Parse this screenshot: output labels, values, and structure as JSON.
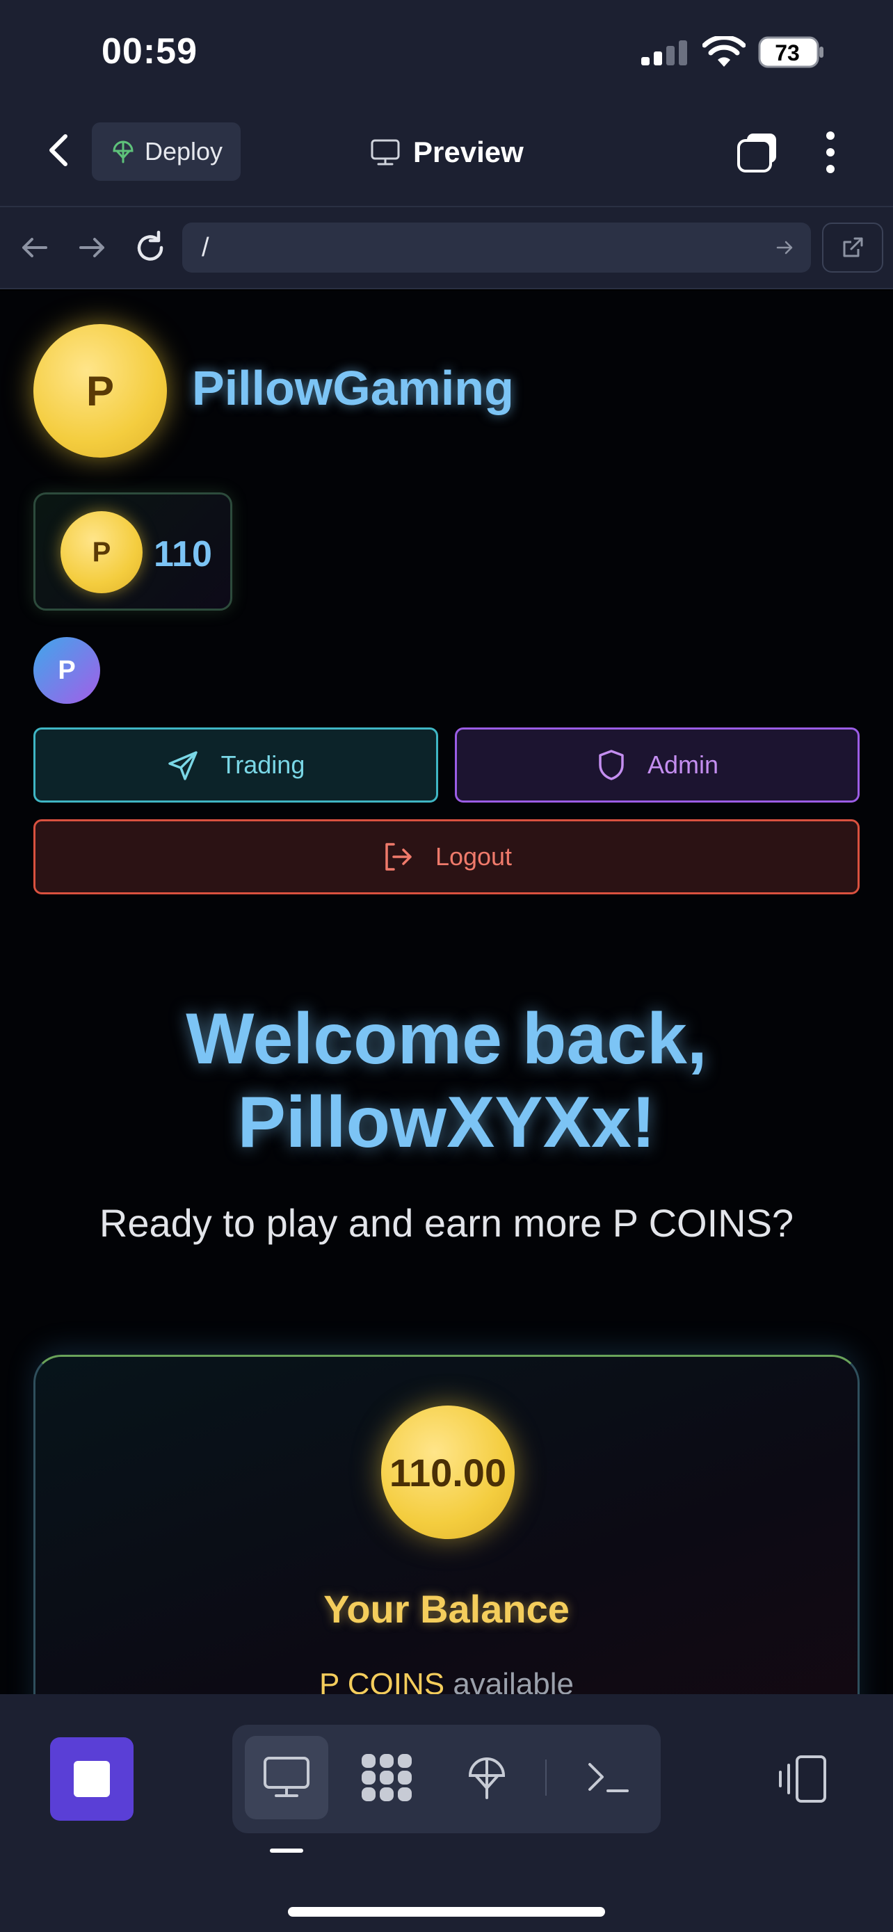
{
  "status_bar": {
    "time": "00:59",
    "battery": "73"
  },
  "topbar": {
    "deploy_label": "Deploy",
    "title": "Preview"
  },
  "url_bar": {
    "url": "/"
  },
  "site": {
    "logo_letter": "P",
    "brand": "PillowGaming",
    "balance_pill": {
      "coin_letter": "P",
      "amount": "110"
    },
    "avatar_letter": "P",
    "buttons": {
      "trading": "Trading",
      "admin": "Admin",
      "logout": "Logout"
    },
    "welcome_line1": "Welcome back,",
    "welcome_line2": "PillowXYXx!",
    "tagline": "Ready to play and earn more P COINS?",
    "balance_card": {
      "amount": "110.00",
      "title": "Your Balance",
      "sub_accent": "P COINS",
      "sub_rest": " available"
    }
  },
  "colors": {
    "accent_blue": "#7cc4f5",
    "coin_gold": "#f4cd3f",
    "trading": "#3fb6c4",
    "admin": "#9b5de5",
    "logout": "#d9513f",
    "stop_button": "#5a3fd6"
  },
  "icons": {
    "status": [
      "signal-icon",
      "wifi-icon",
      "battery-icon"
    ],
    "topbar": [
      "back-chevron-icon",
      "deploy-icon",
      "monitor-icon",
      "tabs-icon",
      "more-icon"
    ],
    "urlbar": [
      "back-arrow-icon",
      "forward-arrow-icon",
      "reload-icon",
      "go-arrow-icon",
      "external-link-icon"
    ],
    "page": [
      "send-icon",
      "shield-icon",
      "logout-icon"
    ],
    "toolbar": [
      "stop-icon",
      "monitor-icon",
      "apps-icon",
      "deploy-icon",
      "terminal-icon",
      "devices-icon"
    ]
  }
}
